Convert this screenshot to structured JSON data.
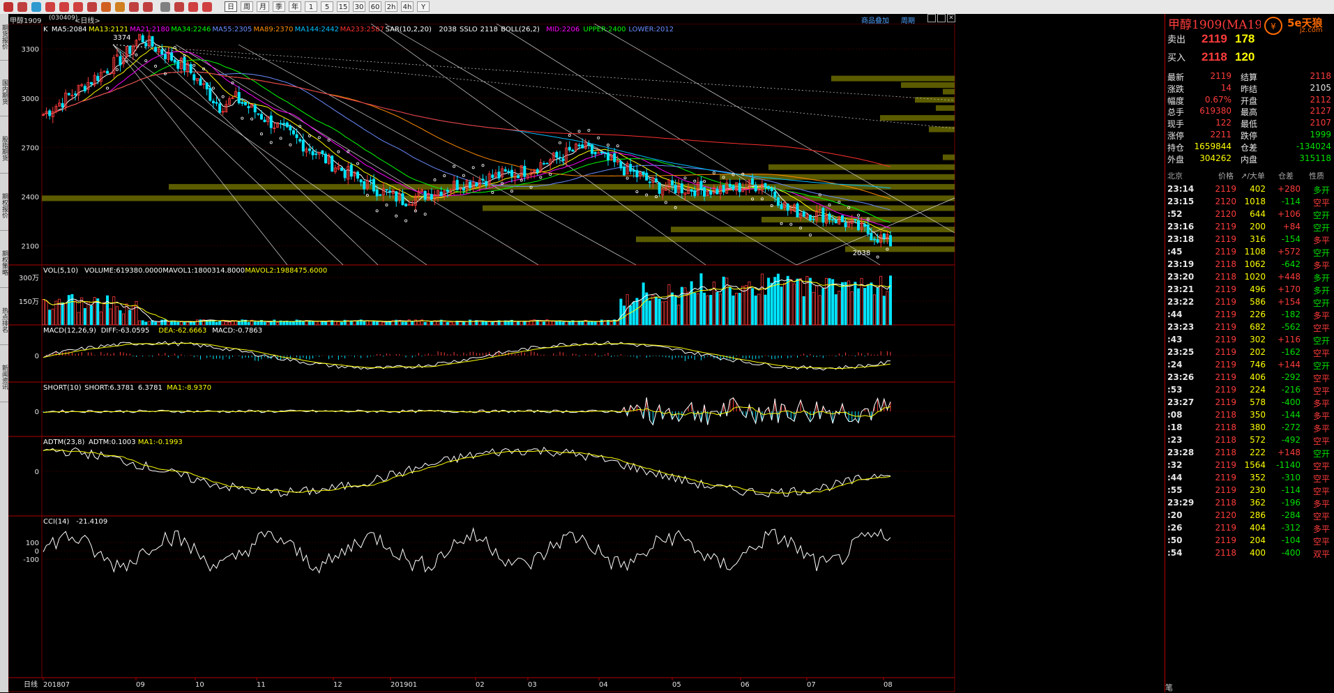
{
  "toolbar": {
    "period_buttons": [
      "日",
      "周",
      "月",
      "季",
      "年",
      "1",
      "5",
      "15",
      "30",
      "60",
      "2h",
      "4h",
      "Y"
    ]
  },
  "title": {
    "instrument": "甲醇1909",
    "code": "(030409)",
    "period": "<日线>",
    "tools": [
      "商品叠加",
      "周期"
    ]
  },
  "left_tabs": [
    "期货报价",
    "国内期货",
    "股指期货",
    "期权报价",
    "期权策略",
    "热点排名",
    "新闻资讯"
  ],
  "panes": {
    "main": {
      "legend": [
        {
          "text": "K",
          "color": "#ffffff"
        },
        {
          "text": "MA5:2084",
          "color": "#ffffff"
        },
        {
          "text": "MA13:2121",
          "color": "#ffff00"
        },
        {
          "text": "MA21:2180",
          "color": "#ff00ff"
        },
        {
          "text": "MA34:2246",
          "color": "#00ff00"
        },
        {
          "text": "MA55:2305",
          "color": "#6a8cff"
        },
        {
          "text": "MA89:2370",
          "color": "#ff8c00"
        },
        {
          "text": "MA144:2442",
          "color": "#00bfff"
        },
        {
          "text": "MA233:2587",
          "color": "#ff3030"
        },
        {
          "text": "SAR(10,2,20)",
          "color": "#ffffff"
        },
        {
          "text": "2038",
          "color": "#ffffff"
        },
        {
          "text": "SSLO",
          "color": "#ffffff"
        },
        {
          "text": "2118",
          "color": "#ffffff"
        },
        {
          "text": "BOLL(26,2)",
          "color": "#ffffff"
        },
        {
          "text": "MID:2206",
          "color": "#ff00ff"
        },
        {
          "text": "UPPER:2400",
          "color": "#00ff00"
        },
        {
          "text": "LOWER:2012",
          "color": "#6a8cff"
        }
      ],
      "ylabels": [
        "3300",
        "3000",
        "2700",
        "2400",
        "2100"
      ],
      "ann_high": "3374",
      "ann_low": "2038"
    },
    "volume": {
      "legend": [
        {
          "text": "VOL(5,10)",
          "color": "#ffffff"
        },
        {
          "text": "VOLUME:619380.0000",
          "color": "#ffffff"
        },
        {
          "text": "MAVOL1:1800314.8000",
          "color": "#ffffff"
        },
        {
          "text": "MAVOL2:1988475.6000",
          "color": "#ffff00"
        }
      ],
      "ylabels": [
        "300万",
        "150万"
      ]
    },
    "macd": {
      "legend": [
        {
          "text": "MACD(12,26,9)",
          "color": "#ffffff"
        },
        {
          "text": "DIFF:-63.0595",
          "color": "#ffffff"
        },
        {
          "text": "DEA:-62.6663",
          "color": "#ffff00"
        },
        {
          "text": "MACD:-0.7863",
          "color": "#ffffff"
        }
      ],
      "ylabels": [
        "0"
      ]
    },
    "short": {
      "legend": [
        {
          "text": "SHORT(10)",
          "color": "#ffffff"
        },
        {
          "text": "SHORT:6.3781",
          "color": "#ffffff"
        },
        {
          "text": "6.3781",
          "color": "#ffffff"
        },
        {
          "text": "MA1:-8.9370",
          "color": "#ffff00"
        }
      ],
      "ylabels": [
        "0"
      ]
    },
    "adtm": {
      "legend": [
        {
          "text": "ADTM(23,8)",
          "color": "#ffffff"
        },
        {
          "text": "ADTM:0.1003",
          "color": "#ffffff"
        },
        {
          "text": "MA1:-0.1993",
          "color": "#ffff00"
        }
      ],
      "ylabels": [
        "0"
      ]
    },
    "cci": {
      "legend": [
        {
          "text": "CCI(14)",
          "color": "#ffffff"
        },
        {
          "text": "-21.4109",
          "color": "#ffffff"
        }
      ],
      "ylabels": [
        "100",
        "0",
        "-100"
      ]
    }
  },
  "xaxis": {
    "label": "日线",
    "ticks": [
      "201807",
      "09",
      "10",
      "11",
      "12",
      "201901",
      "02",
      "03",
      "04",
      "05",
      "06",
      "07",
      "08"
    ]
  },
  "quote": {
    "header": "甲醇1909(MA1909)",
    "sell_label": "卖出",
    "sell_price": "2119",
    "sell_vol": "178",
    "buy_label": "买入",
    "buy_price": "2118",
    "buy_vol": "120",
    "stats": [
      [
        "最新",
        "2119",
        "结算",
        "2118"
      ],
      [
        "涨跌",
        "14",
        "昨结",
        "2105"
      ],
      [
        "幅度",
        "0.67%",
        "开盘",
        "2112"
      ],
      [
        "总手",
        "619380",
        "最高",
        "2127"
      ],
      [
        "现手",
        "122",
        "最低",
        "2107"
      ],
      [
        "涨停",
        "2211",
        "跌停",
        "1999"
      ],
      [
        "持仓",
        "1659844",
        "仓差",
        "-134024"
      ],
      [
        "外盘",
        "304262",
        "内盘",
        "315118"
      ]
    ],
    "tick_header": [
      "北京",
      "价格",
      "↗/大单",
      "仓差",
      "性质"
    ],
    "ticks": [
      [
        "23:14",
        "2119",
        "402",
        "+280",
        "多开"
      ],
      [
        "23:15",
        "2120",
        "1018",
        "-114",
        "空平"
      ],
      [
        ":52",
        "2120",
        "644",
        "+106",
        "空开"
      ],
      [
        "23:16",
        "2119",
        "200",
        "+84",
        "空开"
      ],
      [
        "23:18",
        "2119",
        "316",
        "-154",
        "多平"
      ],
      [
        ":45",
        "2119",
        "1108",
        "+572",
        "空开"
      ],
      [
        "23:19",
        "2118",
        "1062",
        "-642",
        "多平"
      ],
      [
        "23:20",
        "2118",
        "1020",
        "+448",
        "多开"
      ],
      [
        "23:21",
        "2119",
        "496",
        "+170",
        "多开"
      ],
      [
        "23:22",
        "2119",
        "586",
        "+154",
        "空开"
      ],
      [
        ":44",
        "2119",
        "226",
        "-182",
        "多平"
      ],
      [
        "23:23",
        "2119",
        "682",
        "-562",
        "空平"
      ],
      [
        ":43",
        "2119",
        "302",
        "+116",
        "空开"
      ],
      [
        "23:25",
        "2119",
        "202",
        "-162",
        "空平"
      ],
      [
        ":24",
        "2119",
        "746",
        "+144",
        "空开"
      ],
      [
        "23:26",
        "2119",
        "406",
        "-292",
        "空平"
      ],
      [
        ":53",
        "2119",
        "224",
        "-216",
        "空平"
      ],
      [
        "23:27",
        "2119",
        "578",
        "-400",
        "多平"
      ],
      [
        ":08",
        "2118",
        "350",
        "-144",
        "多平"
      ],
      [
        ":18",
        "2118",
        "380",
        "-272",
        "多平"
      ],
      [
        ":23",
        "2118",
        "572",
        "-492",
        "空平"
      ],
      [
        "23:28",
        "2118",
        "222",
        "+148",
        "空开"
      ],
      [
        ":32",
        "2119",
        "1564",
        "-1140",
        "空平"
      ],
      [
        ":44",
        "2119",
        "352",
        "-310",
        "空平"
      ],
      [
        ":55",
        "2119",
        "230",
        "-114",
        "空平"
      ],
      [
        "23:29",
        "2118",
        "362",
        "-196",
        "多平"
      ],
      [
        ":20",
        "2120",
        "286",
        "-284",
        "空平"
      ],
      [
        ":26",
        "2119",
        "404",
        "-312",
        "多平"
      ],
      [
        ":50",
        "2119",
        "204",
        "-104",
        "空平"
      ],
      [
        ":54",
        "2118",
        "400",
        "-400",
        "双平"
      ]
    ],
    "footer_label": "笔"
  },
  "logo": {
    "text": "5e天狼",
    "sub": "jz.com"
  },
  "colors": {
    "up": "#ff3c3c",
    "down": "#00e5ff",
    "grid": "#7a0000",
    "volume_zone": "#6b6b00"
  },
  "chart_data": {
    "type": "candlestick",
    "x_range": [
      "201807",
      "201908"
    ],
    "price_ylim": [
      1950,
      3420
    ],
    "close_path": [
      [
        "201807",
        2900
      ],
      [
        "201808",
        3250
      ],
      [
        "201808b",
        3374
      ],
      [
        "201809",
        3180
      ],
      [
        "201809b",
        2950
      ],
      [
        "201810",
        3000
      ],
      [
        "201810b",
        2800
      ],
      [
        "201811",
        2600
      ],
      [
        "201811b",
        2480
      ],
      [
        "201812",
        2380
      ],
      [
        "201812b",
        2420
      ],
      [
        "201901",
        2480
      ],
      [
        "201902",
        2560
      ],
      [
        "201903",
        2700
      ],
      [
        "201903b",
        2600
      ],
      [
        "201904",
        2460
      ],
      [
        "201905",
        2440
      ],
      [
        "201906",
        2480
      ],
      [
        "201906b",
        2320
      ],
      [
        "201907",
        2280
      ],
      [
        "201907b",
        2200
      ],
      [
        "201908",
        2119
      ]
    ],
    "annotations": {
      "high": 3374,
      "low": 2038
    }
  }
}
